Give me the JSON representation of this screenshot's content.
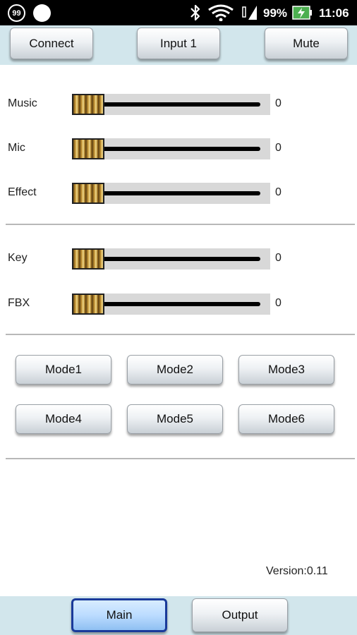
{
  "status_bar": {
    "badge": "99",
    "battery_percent": "99%",
    "time": "11:06",
    "icons": [
      "notification-count-icon",
      "circle-notification-icon",
      "bluetooth-icon",
      "wifi-icon",
      "signal-icon",
      "battery-charging-icon"
    ]
  },
  "toolbar": {
    "connect": "Connect",
    "input": "Input 1",
    "mute": "Mute"
  },
  "mixer": [
    {
      "label": "Music",
      "value": "0"
    },
    {
      "label": "Mic",
      "value": "0"
    },
    {
      "label": "Effect",
      "value": "0"
    }
  ],
  "tone": [
    {
      "label": "Key",
      "value": "0"
    },
    {
      "label": "FBX",
      "value": "0"
    }
  ],
  "modes": [
    "Mode1",
    "Mode2",
    "Mode3",
    "Mode4",
    "Mode5",
    "Mode6"
  ],
  "version": "Version:0.11",
  "tabs": {
    "main": "Main",
    "output": "Output",
    "active": "Main"
  },
  "colors": {
    "bar_background": "#d2e6ec",
    "active_tab_border": "#1a3a9a",
    "slider_track": "#000000",
    "slider_background": "#d8d8d8"
  }
}
